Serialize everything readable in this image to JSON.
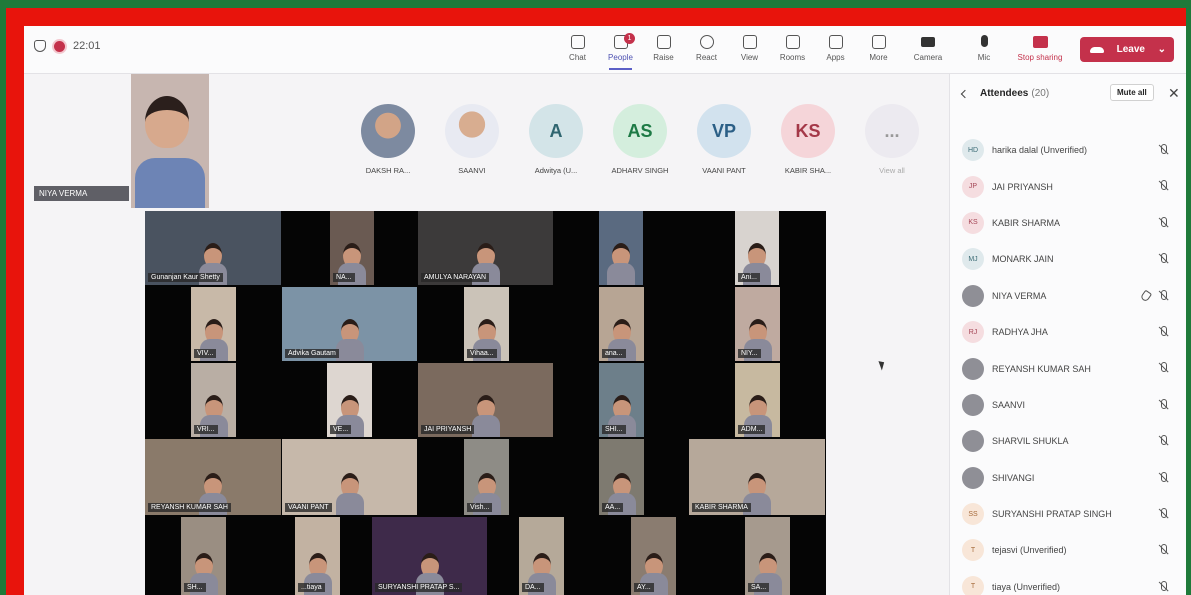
{
  "topbar": {
    "timer": "22:01",
    "tools": [
      {
        "label": "Chat",
        "icon": "chat-icon"
      },
      {
        "label": "People",
        "icon": "people-icon",
        "badge": "1",
        "active": true
      },
      {
        "label": "Raise",
        "icon": "hand-icon"
      },
      {
        "label": "React",
        "icon": "smile-icon"
      },
      {
        "label": "View",
        "icon": "grid-icon"
      },
      {
        "label": "Rooms",
        "icon": "rooms-icon"
      },
      {
        "label": "Apps",
        "icon": "plus-icon"
      },
      {
        "label": "More",
        "icon": "ellipsis-icon"
      }
    ],
    "camera_label": "Camera",
    "mic_label": "Mic",
    "share_label": "Stop sharing",
    "leave_label": "Leave"
  },
  "self_view": {
    "name": "NIYA VERMA"
  },
  "strip": [
    {
      "name": "DAKSH RA...",
      "type": "photo"
    },
    {
      "name": "SAANVI",
      "type": "photo"
    },
    {
      "initials": "A",
      "name": "Adwitya (U...",
      "color": "A"
    },
    {
      "initials": "AS",
      "name": "ADHARV SINGH",
      "color": "AS"
    },
    {
      "initials": "VP",
      "name": "VAANI PANT",
      "color": "VP"
    },
    {
      "initials": "KS",
      "name": "KABIR SHA...",
      "color": "KS"
    },
    {
      "initials": "...",
      "name": "View all",
      "color": "more"
    }
  ],
  "grid": [
    {
      "label": "Gunanjan Kaur Shetty",
      "bg": "#4a5360"
    },
    {
      "label": "NA...",
      "bg": "#6a5a52"
    },
    {
      "label": "AMULYA NARAYAN",
      "bg": "#3c3a3a"
    },
    {
      "label": "",
      "bg": "#5a6a80"
    },
    {
      "label": "Ani...",
      "bg": "#d8d3cf"
    },
    {
      "label": "VIV...",
      "bg": "#c8b9a8"
    },
    {
      "label": "Advika Gautam",
      "bg": "#7c93a6"
    },
    {
      "label": "Vihaa...",
      "bg": "#cbc3b8"
    },
    {
      "label": "ana...",
      "bg": "#b7a594"
    },
    {
      "label": "NIY...",
      "bg": "#bfaaa0"
    },
    {
      "label": "VRI...",
      "bg": "#b9aea4"
    },
    {
      "label": "VE...",
      "bg": "#ddd6d0"
    },
    {
      "label": "JAI PRIYANSH",
      "bg": "#7b6a5e"
    },
    {
      "label": "SHI...",
      "bg": "#6d7f8a"
    },
    {
      "label": "ADM...",
      "bg": "#c7b9a0"
    },
    {
      "label": "REYANSH KUMAR SAH",
      "bg": "#8a7a6a"
    },
    {
      "label": "VAANI PANT",
      "bg": "#c6b8aa"
    },
    {
      "label": "Vish...",
      "bg": "#8e8c86"
    },
    {
      "label": "AA...",
      "bg": "#7e7a70"
    },
    {
      "label": "KABIR SHARMA",
      "bg": "#b6a89a"
    },
    {
      "label": "SH...",
      "bg": "#9a8e82"
    },
    {
      "label": "...tiaya",
      "bg": "#c2b2a2"
    },
    {
      "label": "SURYANSHI PRATAP S...",
      "bg": "#3e2a4a"
    },
    {
      "label": "DA...",
      "bg": "#b5a999"
    },
    {
      "label": "AY...",
      "bg": "#8a7c70"
    },
    {
      "label": "SA...",
      "bg": "#a69a8e"
    }
  ],
  "panel": {
    "title": "Attendees",
    "count": "(20)",
    "mute_all": "Mute all",
    "close_glyph": "✕",
    "attendees": [
      {
        "initials": "HD",
        "name": "harika dalal (Unverified)",
        "color": "HD"
      },
      {
        "initials": "JP",
        "name": "JAI PRIYANSH",
        "color": "JP"
      },
      {
        "initials": "KS",
        "name": "KABIR SHARMA",
        "color": "KS"
      },
      {
        "initials": "MJ",
        "name": "MONARK JAIN",
        "color": "MJ"
      },
      {
        "initials": "",
        "name": "NIYA VERMA",
        "color": "photo",
        "pinned": true
      },
      {
        "initials": "RJ",
        "name": "RADHYA JHA",
        "color": "RJ"
      },
      {
        "initials": "",
        "name": "REYANSH KUMAR SAH",
        "color": "photo"
      },
      {
        "initials": "",
        "name": "SAANVI",
        "color": "photo"
      },
      {
        "initials": "",
        "name": "SHARVIL SHUKLA",
        "color": "photo"
      },
      {
        "initials": "",
        "name": "SHIVANGI",
        "color": "photo"
      },
      {
        "initials": "SS",
        "name": "SURYANSHI PRATAP SINGH",
        "color": "SS"
      },
      {
        "initials": "T",
        "name": "tejasvi (Unverified)",
        "color": "T"
      },
      {
        "initials": "T",
        "name": "tiaya (Unverified)",
        "color": "T"
      }
    ]
  }
}
